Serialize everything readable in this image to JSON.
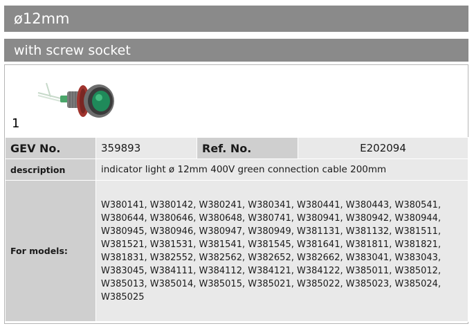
{
  "header": {
    "size": "ø12mm",
    "variant": "with screw socket"
  },
  "image": {
    "label": "1",
    "icon": "indicator-light-icon"
  },
  "spec": {
    "gev_label": "GEV No.",
    "gev_value": "359893",
    "ref_label": "Ref. No.",
    "ref_value": "E202094",
    "description_label": "description",
    "description_value": "indicator light  ø 12mm 400V green connection cable 200mm",
    "models_label": "For models:",
    "models_value": "W380141, W380142, W380241, W380341, W380441, W380443, W380541, W380644, W380646, W380648, W380741, W380941, W380942, W380944, W380945, W380946, W380947, W380949, W381131, W381132, W381511, W381521, W381531, W381541, W381545, W381641, W381811, W381821, W381831, W382552, W382562, W382652, W382662, W383041, W383043, W383045, W384111, W384112, W384121, W384122, W385011, W385012, W385013, W385014, W385015, W385021, W385022, W385023, W385024, W385025"
  },
  "colors": {
    "header_bg": "#8a8a8a",
    "key_bg": "#cfcfcf",
    "value_bg": "#e9e9e9",
    "lamp_green": "#1f8a5a",
    "bezel_red": "#a0342e"
  }
}
